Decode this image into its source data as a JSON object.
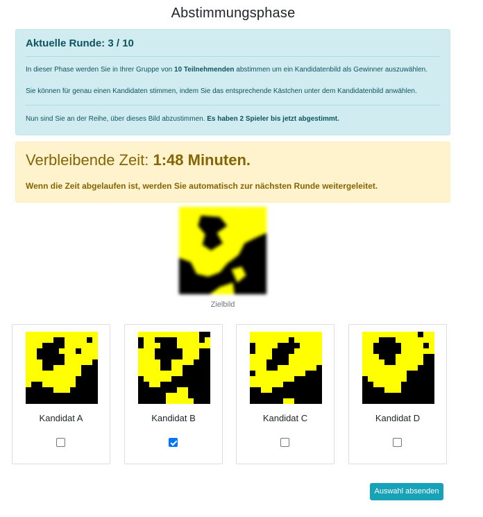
{
  "page": {
    "title": "Abstimmungsphase"
  },
  "info": {
    "heading": "Aktuelle Runde: 3 / 10",
    "para1_pre": "In dieser Phase werden Sie in Ihrer Gruppe von ",
    "para1_bold": "10 Teilnehmenden",
    "para1_post": " abstimmen um ein Kandidatenbild als Gewinner auszuwählen.",
    "para2": "Sie können für genau einen Kandidaten stimmen, indem Sie das entsprechende Kästchen unter dem Kandidatenbild anwählen.",
    "para3_pre": "Nun sind Sie an der Reihe, über dieses Bild abzustimmen. ",
    "para3_bold": "Es haben 2 Spieler bis jetzt abgestimmt."
  },
  "timer": {
    "label": "Verbleibende Zeit: ",
    "value": "1:48 Minuten.",
    "note": "Wenn die Zeit abgelaufen ist, werden Sie automatisch zur nächsten Runde weitergeleitet."
  },
  "target": {
    "label": "Zielbild"
  },
  "candidates": [
    {
      "name": "Kandidat A",
      "checked": false
    },
    {
      "name": "Kandidat B",
      "checked": true
    },
    {
      "name": "Kandidat C",
      "checked": false
    },
    {
      "name": "Kandidat D",
      "checked": false
    }
  ],
  "colors": {
    "pattern_fill": "#ffff00",
    "pattern_ink": "#000000",
    "accent": "#17a2b8"
  },
  "submit": {
    "label": "Auswahl absenden"
  }
}
